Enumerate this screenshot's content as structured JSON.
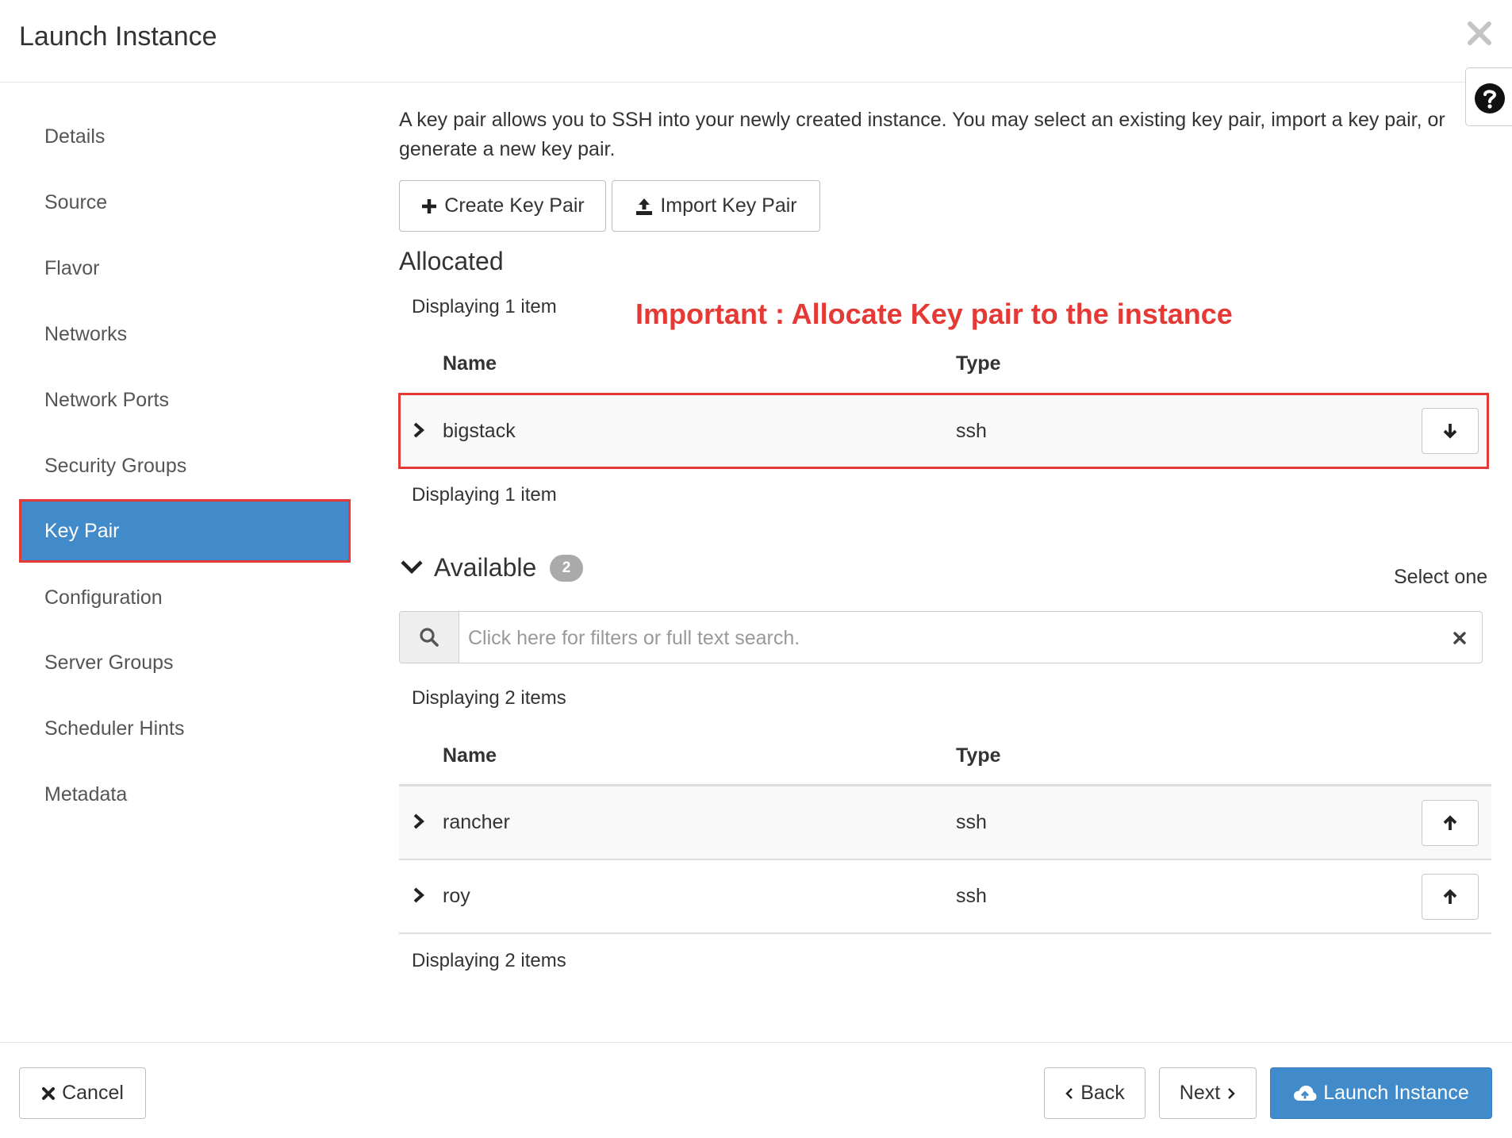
{
  "modal": {
    "title": "Launch Instance"
  },
  "sidebar": {
    "items": [
      {
        "label": "Details"
      },
      {
        "label": "Source"
      },
      {
        "label": "Flavor"
      },
      {
        "label": "Networks"
      },
      {
        "label": "Network Ports"
      },
      {
        "label": "Security Groups"
      },
      {
        "label": "Key Pair",
        "active": true
      },
      {
        "label": "Configuration"
      },
      {
        "label": "Server Groups"
      },
      {
        "label": "Scheduler Hints"
      },
      {
        "label": "Metadata"
      }
    ]
  },
  "content": {
    "intro": "A key pair allows you to SSH into your newly created instance. You may select an existing key pair, import a key pair, or generate a new key pair.",
    "create_button": "Create Key Pair",
    "import_button": "Import Key Pair",
    "annotation": "Important : Allocate Key pair to the instance",
    "allocated": {
      "title": "Allocated",
      "count_top": "Displaying 1 item",
      "count_bottom": "Displaying 1 item",
      "columns": {
        "name": "Name",
        "type": "Type"
      },
      "rows": [
        {
          "name": "bigstack",
          "type": "ssh"
        }
      ]
    },
    "available": {
      "title": "Available",
      "badge": "2",
      "select_hint": "Select one",
      "search_placeholder": "Click here for filters or full text search.",
      "count_top": "Displaying 2 items",
      "count_bottom": "Displaying 2 items",
      "columns": {
        "name": "Name",
        "type": "Type"
      },
      "rows": [
        {
          "name": "rancher",
          "type": "ssh"
        },
        {
          "name": "roy",
          "type": "ssh"
        }
      ]
    }
  },
  "footer": {
    "cancel": "Cancel",
    "back": "Back",
    "next": "Next",
    "launch": "Launch Instance"
  },
  "colors": {
    "primary": "#428bca",
    "highlight": "#e53935",
    "badge": "#aaaaaa"
  }
}
